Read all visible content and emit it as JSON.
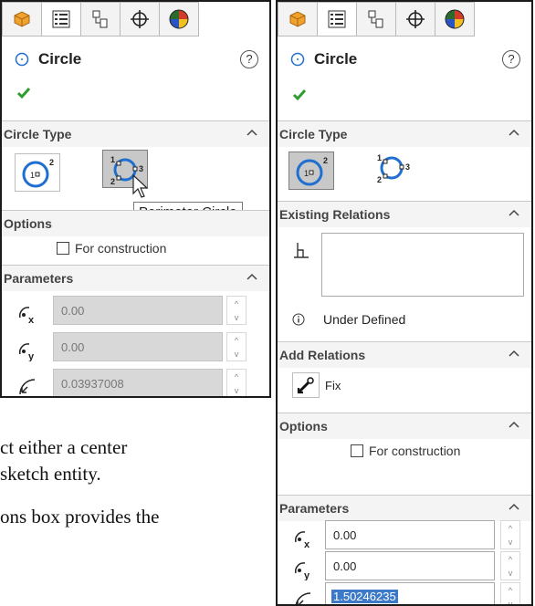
{
  "left_panel": {
    "title": "Circle",
    "help": "?",
    "sections": {
      "circle_type": "Circle Type",
      "options": "Options",
      "parameters": "Parameters"
    },
    "tooltip": "Perimeter Circle",
    "construction_label": "For construction",
    "params": {
      "x": "0.00",
      "y": "0.00",
      "radius": "0.03937008"
    }
  },
  "right_panel": {
    "title": "Circle",
    "help": "?",
    "sections": {
      "circle_type": "Circle Type",
      "existing_relations": "Existing Relations",
      "add_relations": "Add Relations",
      "options": "Options",
      "parameters": "Parameters"
    },
    "status": "Under Defined",
    "fix_label": "Fix",
    "construction_label": "For construction",
    "params": {
      "x": "0.00",
      "y": "0.00",
      "radius": "1.50246235"
    }
  },
  "body_text": [
    "ct either a center",
    "sketch entity.",
    "ons box provides the"
  ],
  "colors": {
    "accent_blue": "#1f6fd0",
    "check_green": "#2e9d2e",
    "highlight": "#3c7ac9"
  }
}
